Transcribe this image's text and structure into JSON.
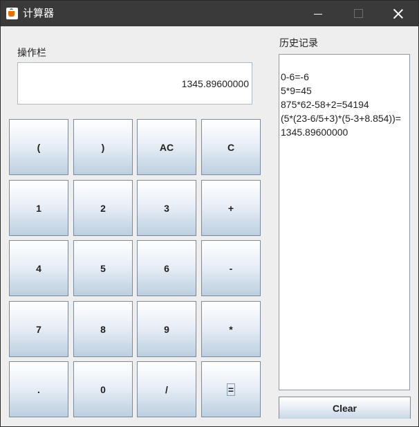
{
  "window": {
    "title": "计算器",
    "minimize_icon": "minimize-icon",
    "maximize_icon": "maximize-icon",
    "close_icon": "close-icon"
  },
  "operation": {
    "label": "操作栏",
    "display_value": "1345.89600000"
  },
  "keypad": {
    "rows": [
      [
        "(",
        ")",
        "AC",
        "C"
      ],
      [
        "1",
        "2",
        "3",
        "+"
      ],
      [
        "4",
        "5",
        "6",
        "-"
      ],
      [
        "7",
        "8",
        "9",
        "*"
      ],
      [
        ".",
        "0",
        "/",
        "="
      ]
    ]
  },
  "history": {
    "label": "历史记录",
    "lines": [
      "0-6=-6",
      "5*9=45",
      "875*62-58+2=54194",
      "(5*(23-6/5+3)*(5-3+8.854))=",
      "1345.89600000"
    ],
    "clear_label": "Clear"
  },
  "colors": {
    "titlebar": "#3a3a3a",
    "background": "#eeeeee",
    "button_gradient_top": "#ffffff",
    "button_gradient_bottom": "#bccfe0",
    "border": "#7a8a99"
  }
}
